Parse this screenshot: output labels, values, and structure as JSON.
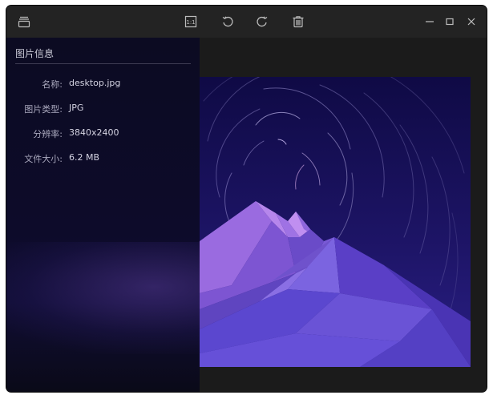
{
  "info_panel": {
    "title": "图片信息",
    "rows": [
      {
        "label": "名称:",
        "value": "desktop.jpg"
      },
      {
        "label": "图片类型:",
        "value": "JPG"
      },
      {
        "label": "分辨率:",
        "value": "3840x2400"
      },
      {
        "label": "文件大小:",
        "value": "6.2 MB"
      }
    ]
  },
  "toolbar": {
    "icons": [
      "thumbnail-panel-icon",
      "actual-size-icon",
      "rotate-left-icon",
      "rotate-right-icon",
      "trash-icon"
    ]
  },
  "window_controls": [
    "minimize-icon",
    "maximize-icon",
    "close-icon"
  ],
  "colors": {
    "background": "#1b1b1b",
    "titlebar": "#232323",
    "icon": "#bdbdbd",
    "sky": "#1a1260",
    "mountain": "#6a4fd8"
  }
}
